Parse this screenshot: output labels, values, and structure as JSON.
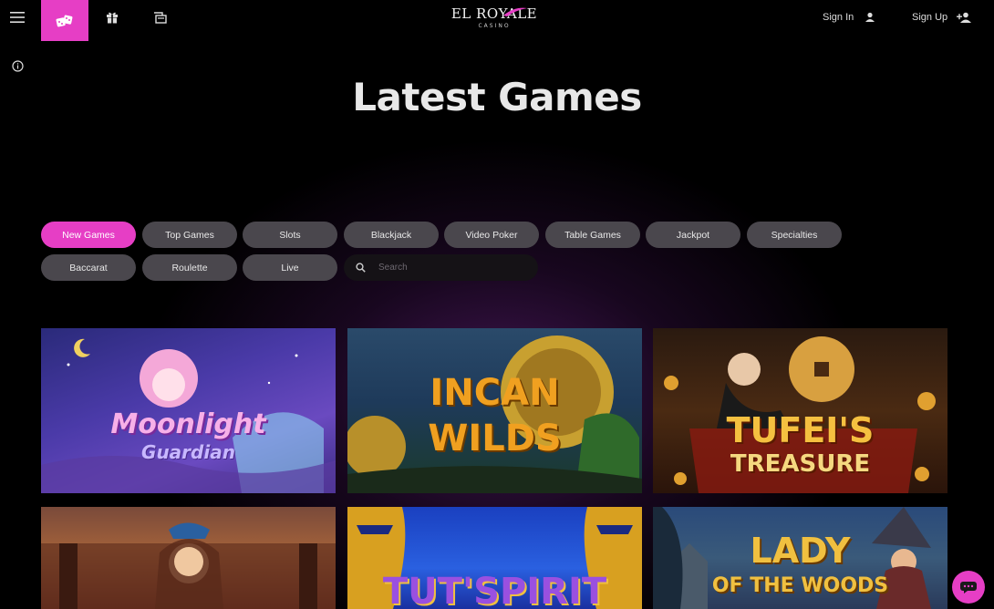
{
  "header": {
    "logo_main": "EL ROYALE",
    "logo_sub": "CASINO",
    "signin_label": "Sign In",
    "signup_label": "Sign Up",
    "icons": [
      "menu-icon",
      "dice-icon",
      "gift-icon",
      "promotions-icon",
      "info-icon",
      "user-icon",
      "add-user-icon",
      "chat-icon"
    ]
  },
  "page": {
    "title": "Latest Games"
  },
  "filters": {
    "row1": [
      "New Games",
      "Top Games",
      "Slots",
      "Blackjack",
      "Video Poker",
      "Table Games",
      "Jackpot",
      "Specialties"
    ],
    "row2": [
      "Baccarat",
      "Roulette",
      "Live"
    ],
    "active": "New Games"
  },
  "search": {
    "placeholder": "Search"
  },
  "games": [
    {
      "title_line1": "Moonlight",
      "title_line2": "Guardian"
    },
    {
      "title_line1": "INCAN",
      "title_line2": "WILDS"
    },
    {
      "title_line1": "TUFEI'S",
      "title_line2": "TREASURE"
    },
    {
      "title_line1": "",
      "title_line2": ""
    },
    {
      "title_line1": "TUT'SPIRIT",
      "title_line2": ""
    },
    {
      "title_line1": "LADY",
      "title_line2": "OF THE WOODS"
    }
  ],
  "colors": {
    "accent": "#e63ec5",
    "pill_bg": "#4a474d",
    "background": "#000000"
  }
}
